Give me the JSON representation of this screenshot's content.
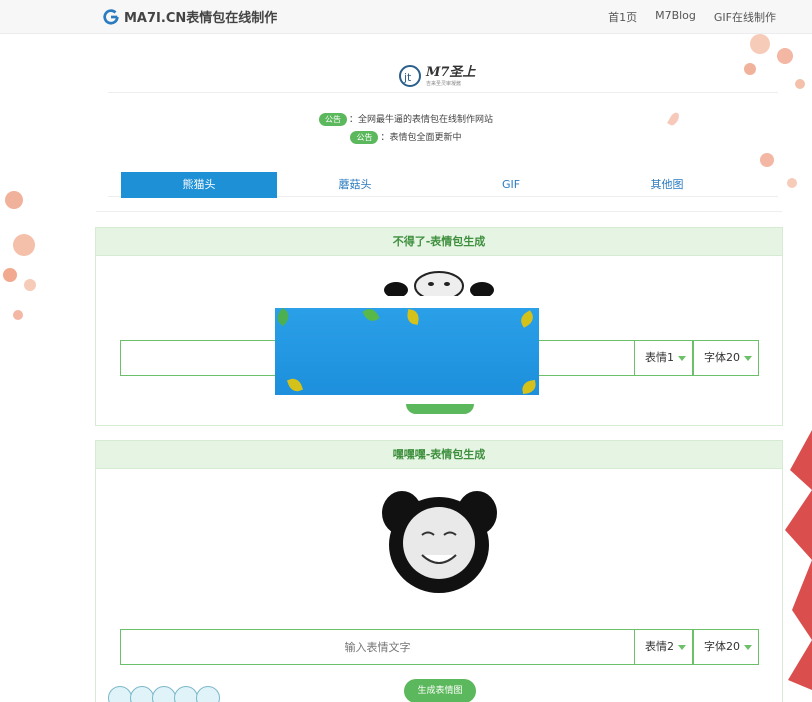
{
  "topbar": {
    "logo_text": "MA7I.CN表情包在线制作",
    "nav": [
      "首1页",
      "M7Blog",
      "GIF在线制作"
    ]
  },
  "site_logo": {
    "title": "M7圣上",
    "subtitle": "吉来圣灵审凝酱"
  },
  "notices": [
    {
      "badge": "公告",
      "text": "：全网最牛逼的表情包在线制作网站"
    },
    {
      "badge": "公告",
      "text": "：表情包全面更新中"
    }
  ],
  "tabs": [
    "熊猫头",
    "蘑菇头",
    "GIF",
    "其他图"
  ],
  "active_tab": 0,
  "panels": [
    {
      "title": "不得了-表情包生成",
      "input_value": "",
      "input_placeholder": "",
      "select_expression": "表情1",
      "select_font": "字体20",
      "button": ""
    },
    {
      "title": "嘿嘿嘿-表情包生成",
      "input_value": "",
      "input_placeholder": "输入表情文字",
      "select_expression": "表情2",
      "select_font": "字体20",
      "button": "生成表情图"
    }
  ],
  "colors": {
    "accent_blue": "#1e90d6",
    "accent_green": "#5cb85c",
    "panel_head_bg": "#e6f5e3"
  }
}
